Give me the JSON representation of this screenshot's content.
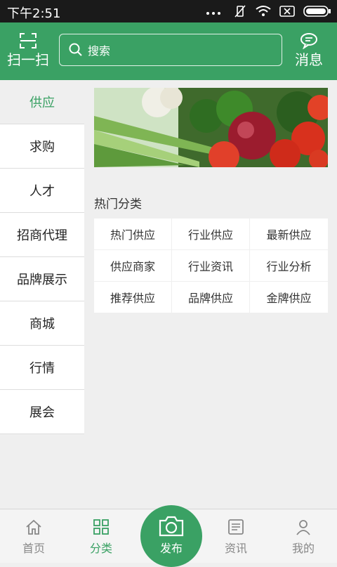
{
  "status_bar": {
    "time": "下午2:51"
  },
  "header": {
    "scan_label": "扫一扫",
    "search_placeholder": "搜索",
    "message_label": "消息"
  },
  "sidebar": {
    "items": [
      {
        "label": "供应",
        "active": true
      },
      {
        "label": "求购"
      },
      {
        "label": "人才"
      },
      {
        "label": "招商代理"
      },
      {
        "label": "品牌展示"
      },
      {
        "label": "商城"
      },
      {
        "label": "行情"
      },
      {
        "label": "展会"
      }
    ]
  },
  "main": {
    "section_title": "热门分类",
    "categories": [
      "热门供应",
      "行业供应",
      "最新供应",
      "供应商家",
      "行业资讯",
      "行业分析",
      "推荐供应",
      "品牌供应",
      "金牌供应"
    ]
  },
  "bottom_nav": {
    "home": "首页",
    "category": "分类",
    "publish": "发布",
    "news": "资讯",
    "mine": "我的",
    "active": "分类"
  },
  "colors": {
    "brand": "#3aa164",
    "status_bar": "#1a1a1a"
  },
  "icons": [
    "scan-icon",
    "search-icon",
    "message-icon",
    "home-icon",
    "grid-icon",
    "camera-icon",
    "news-icon",
    "user-icon"
  ]
}
